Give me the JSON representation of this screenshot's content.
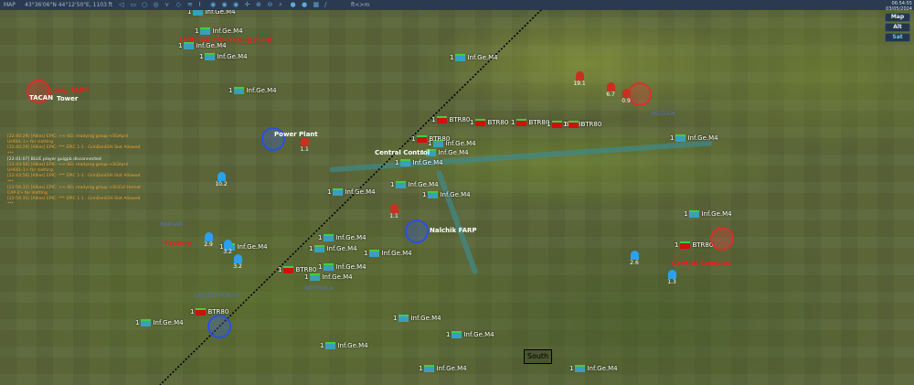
{
  "topbar": {
    "mode": "MAP",
    "coords": "43°36'06\"N 44°12'50\"E, 1103 ft",
    "units": "ft<>m",
    "icons": [
      "send-icon",
      "unit-icon",
      "circle-icon",
      "vehicle-icon",
      "network-icon",
      "diamond-icon",
      "wifi-icon",
      "tower-icon",
      "radar-icon",
      "radar-selected-icon",
      "radar-alt-icon",
      "crosshair-icon",
      "zoom-in-icon",
      "zoom-out-icon",
      "search-icon",
      "globe-icon",
      "sphere-icon",
      "grid-icon",
      "ruler-icon"
    ]
  },
  "clock": {
    "time": "06:54:55",
    "date": "03/05/2024"
  },
  "map_buttons": [
    "Map",
    "Alt",
    "Sat"
  ],
  "log": [
    {
      "t": "[22:40:29] [Allies] EPIC: <<-SG: readying group <SGApril UH60L-1> for slotting",
      "c": "o"
    },
    {
      "t": "[22:40:29] [Allies] EPIC: *** EPIC 1-1 : GrinDonElAl Slot Allowed ***",
      "c": "o"
    },
    {
      "t": "[22:41:07] BLUE player guigpb disconnected",
      "c": "w"
    },
    {
      "t": "[22:43:56] [Allies] EPIC: <<-SG: readying group <SGApril UH60L-1> for slotting",
      "c": "o"
    },
    {
      "t": "[22:43:56] [Allies] EPIC: *** EPIC 1-1 : GrinDonElAl Slot Allowed ***",
      "c": "o"
    },
    {
      "t": "[22:56:31] [Allies] EPIC: <<-SG: readying group <SGCol Hornet CAP-2> for slotting",
      "c": "o"
    },
    {
      "t": "[22:56:31] [Allies] EPIC: *** EPIC 1-1 : GrinDonElAl Slot Allowed ***",
      "c": "o"
    }
  ],
  "units": {
    "count": "1",
    "infantry": "Inf.Ge.M4",
    "apc": "BTR80"
  },
  "threats": [
    "10.2",
    "2.9",
    "3.2",
    "3.2",
    "2.6",
    "1.3",
    "1.1",
    "19.1",
    "6.7",
    "0.9",
    "1.1"
  ],
  "labels": {
    "plant": "Lostenal Processing Plant",
    "farp": "Jump FARP",
    "tacan": "TACAN",
    "tower": "Tower",
    "factory": "Factory",
    "complex": "Central Complex",
    "farp2": "Nalchik FARP",
    "control": "Central Control",
    "power": "Power Plant"
  },
  "places": [
    "BAKSAN",
    "CHEGEM PERVYY",
    "NARTKALA",
    "MOZDOK"
  ],
  "map_label": "South"
}
